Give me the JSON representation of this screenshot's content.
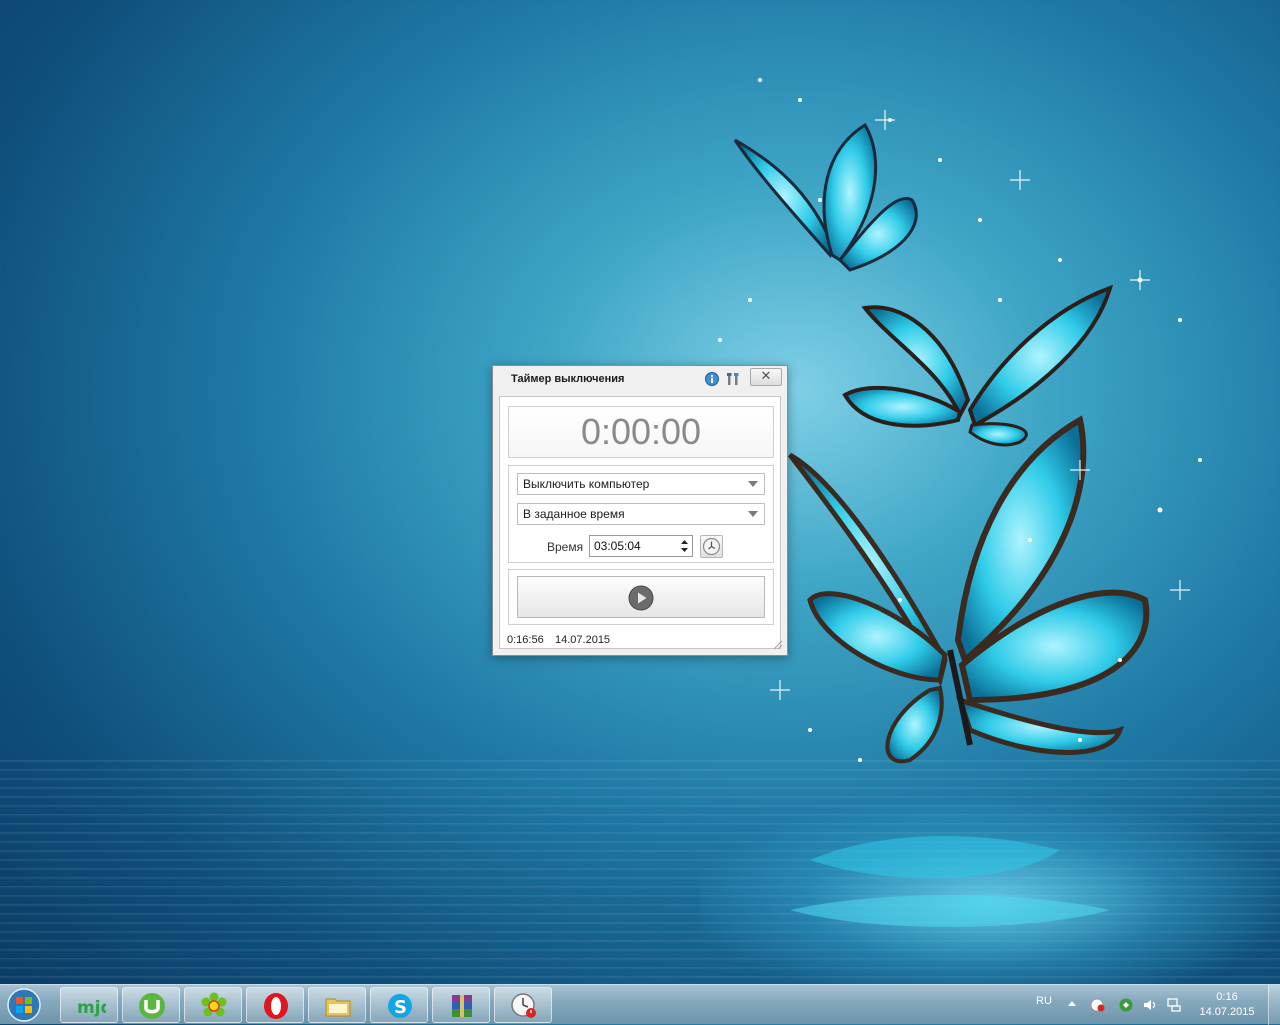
{
  "window": {
    "title": "Таймер выключения",
    "timer_value": "0:00:00",
    "action_select": "Выключить компьютер",
    "mode_select": "В заданное время",
    "time_label": "Время",
    "time_value": "03:05:04",
    "status_time": "0:16:56",
    "status_date": "14.07.2015",
    "close_glyph": "✕"
  },
  "taskbar": {
    "pinned": [
      {
        "name": "md-app",
        "icon": "mjd-logo-icon"
      },
      {
        "name": "utorrent",
        "icon": "utorrent-icon"
      },
      {
        "name": "icq",
        "icon": "icq-flower-icon"
      },
      {
        "name": "opera",
        "icon": "opera-icon"
      },
      {
        "name": "explorer",
        "icon": "folder-icon"
      },
      {
        "name": "skype",
        "icon": "skype-icon"
      },
      {
        "name": "winrar",
        "icon": "winrar-icon"
      },
      {
        "name": "shutdown-timer",
        "icon": "timer-clock-icon"
      }
    ],
    "mjd_text": "mjd",
    "language": "RU",
    "clock_time": "0:16",
    "clock_date": "14.07.2015"
  },
  "colors": {
    "accent_blue": "#1f7aa6",
    "butterfly": "#35d0ee",
    "taskbar": "#86a9bd"
  }
}
